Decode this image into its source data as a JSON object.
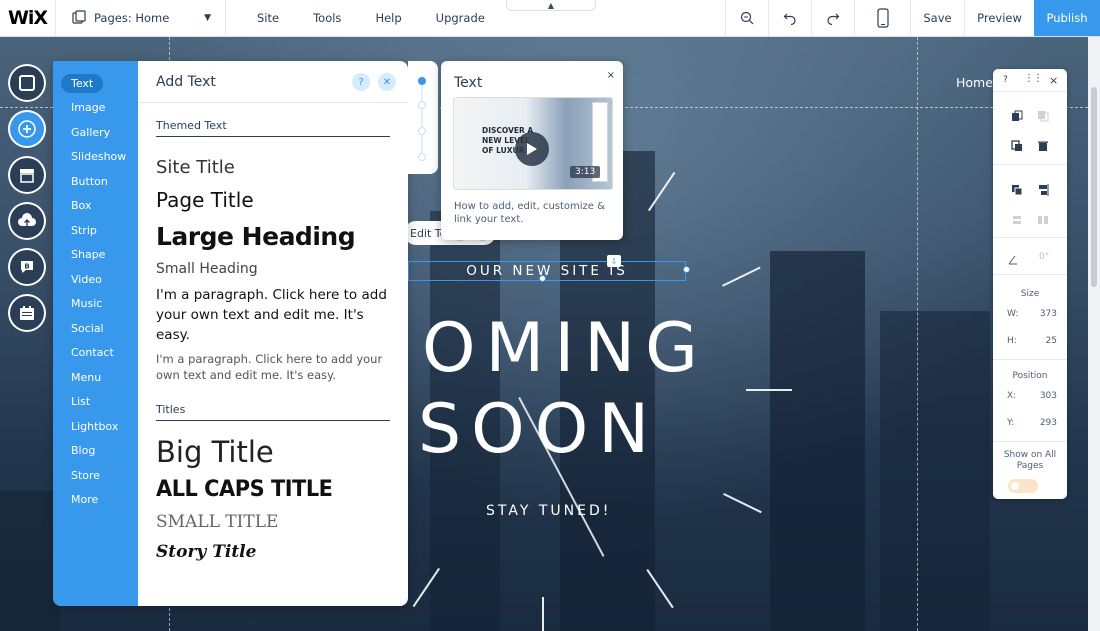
{
  "topbar": {
    "logo": "WiX",
    "pages_label": "Pages: Home",
    "menu": [
      "Site",
      "Tools",
      "Help",
      "Upgrade"
    ],
    "save_label": "Save",
    "preview_label": "Preview",
    "publish_label": "Publish",
    "collapse_glyph": "▲"
  },
  "canvas": {
    "home_link": "Home",
    "subtitle": "OUR NEW SITE IS",
    "line1": "OMING",
    "line2": "SOON",
    "stay_tuned": "STAY TUNED!",
    "edit_text_label": "Edit Te"
  },
  "add_panel": {
    "title": "Add Text",
    "help_glyph": "?",
    "close_glyph": "✕",
    "categories": [
      "Text",
      "Image",
      "Gallery",
      "Slideshow",
      "Button",
      "Box",
      "Strip",
      "Shape",
      "Video",
      "Music",
      "Social",
      "Contact",
      "Menu",
      "List",
      "Lightbox",
      "Blog",
      "Store",
      "More"
    ],
    "themed_section": "Themed Text",
    "themed_items": {
      "site_title": "Site Title",
      "page_title": "Page Title",
      "large_heading": "Large Heading",
      "small_heading": "Small Heading",
      "paragraph_1": "I'm a paragraph. Click here to add your own text and edit me. It's easy.",
      "paragraph_2": "I'm a paragraph. Click here to add your own text and edit me. It's easy."
    },
    "titles_section": "Titles",
    "title_items": {
      "big_title": "Big Title",
      "all_caps": "ALL CAPS TITLE",
      "small_title": "SMALL TITLE",
      "story_title": "Story Title"
    }
  },
  "video_tip": {
    "title": "Text",
    "close_glyph": "×",
    "thumb_text": "DISCOVER A NEW LEVEL OF LUXUR",
    "duration": "3:13",
    "description": "How to add, edit, customize & link your text."
  },
  "inspector": {
    "help_glyph": "?",
    "close_glyph": "×",
    "rotation": "0°",
    "size_label": "Size",
    "w_label": "W:",
    "w_value": "373",
    "h_label": "H:",
    "h_value": "25",
    "position_label": "Position",
    "x_label": "X:",
    "x_value": "303",
    "y_label": "Y:",
    "y_value": "293",
    "show_all_label": "Show on All Pages"
  },
  "colors": {
    "accent": "#3899ec",
    "dark_text": "#2b3e55",
    "canvas_bg": "#2b3e55"
  }
}
